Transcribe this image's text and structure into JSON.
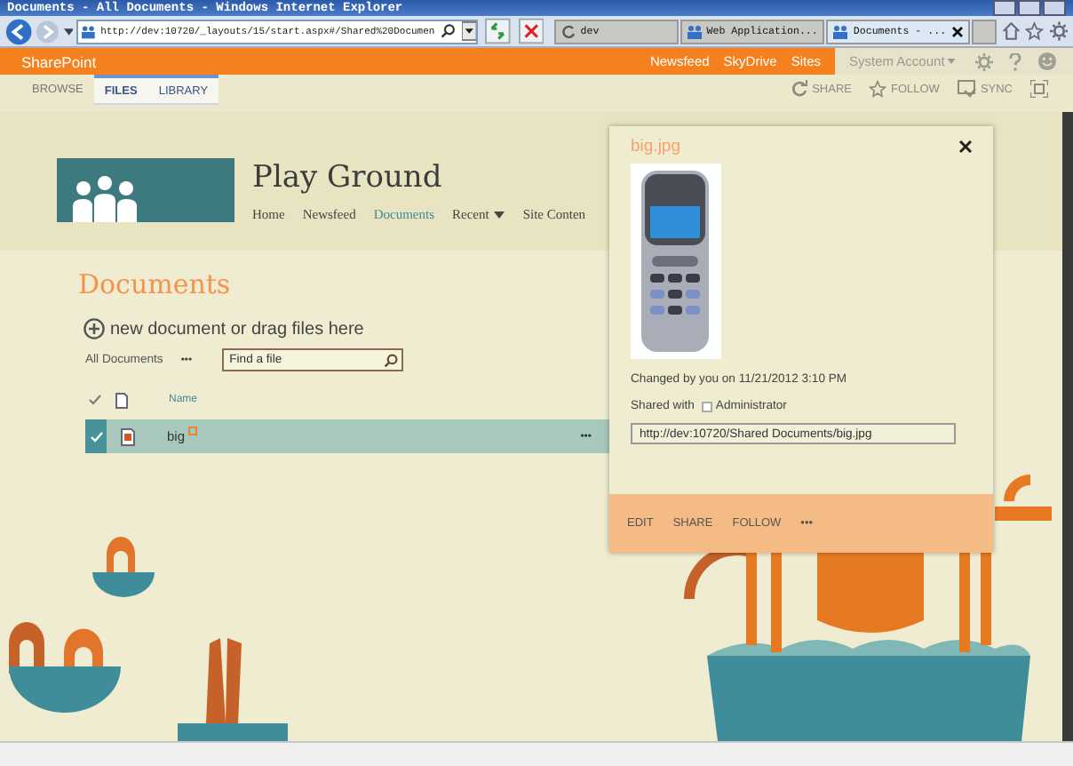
{
  "window": {
    "title": "Documents - All Documents - Windows Internet Explorer"
  },
  "browser": {
    "address": "http://dev:10720/_layouts/15/start.aspx#/Shared%20Documen",
    "tabs": [
      {
        "label": "dev",
        "selected": false,
        "kind": "loading"
      },
      {
        "label": "Web Application...",
        "selected": false,
        "kind": "site"
      },
      {
        "label": "Documents - ...",
        "selected": true,
        "kind": "site"
      }
    ]
  },
  "suite_bar": {
    "brand": "SharePoint",
    "links": [
      "Newsfeed",
      "SkyDrive",
      "Sites"
    ],
    "user": "System Account"
  },
  "ribbon": {
    "tabs": [
      {
        "label": "BROWSE",
        "selected": false,
        "contextual": false
      },
      {
        "label": "FILES",
        "selected": true,
        "contextual": true
      },
      {
        "label": "LIBRARY",
        "selected": false,
        "contextual": true
      }
    ],
    "actions": [
      {
        "label": "SHARE",
        "kind": "share"
      },
      {
        "label": "FOLLOW",
        "kind": "follow"
      },
      {
        "label": "SYNC",
        "kind": "sync"
      }
    ]
  },
  "site": {
    "title": "Play Ground",
    "nav": [
      {
        "label": "Home",
        "selected": false,
        "menu": false
      },
      {
        "label": "Newsfeed",
        "selected": false,
        "menu": false
      },
      {
        "label": "Documents",
        "selected": true,
        "menu": false
      },
      {
        "label": "Recent",
        "selected": false,
        "menu": true
      },
      {
        "label": "Site Conten",
        "selected": false,
        "menu": false
      }
    ]
  },
  "library": {
    "title": "Documents",
    "new_link": "new document or drag files here",
    "view": "All Documents",
    "more": "•••",
    "search": {
      "placeholder": "Find a file"
    },
    "columns": [
      "Name"
    ],
    "rows": [
      {
        "name": "big",
        "selected": true,
        "new": true,
        "more": "•••"
      }
    ]
  },
  "callout": {
    "title": "big.jpg",
    "changed": "Changed by you on 11/21/2012 3:10 PM",
    "shared_label": "Shared with",
    "shared_user": "Administrator",
    "url": "http://dev:10720/Shared Documents/big.jpg",
    "actions": [
      "EDIT",
      "SHARE",
      "FOLLOW",
      "•••"
    ]
  }
}
